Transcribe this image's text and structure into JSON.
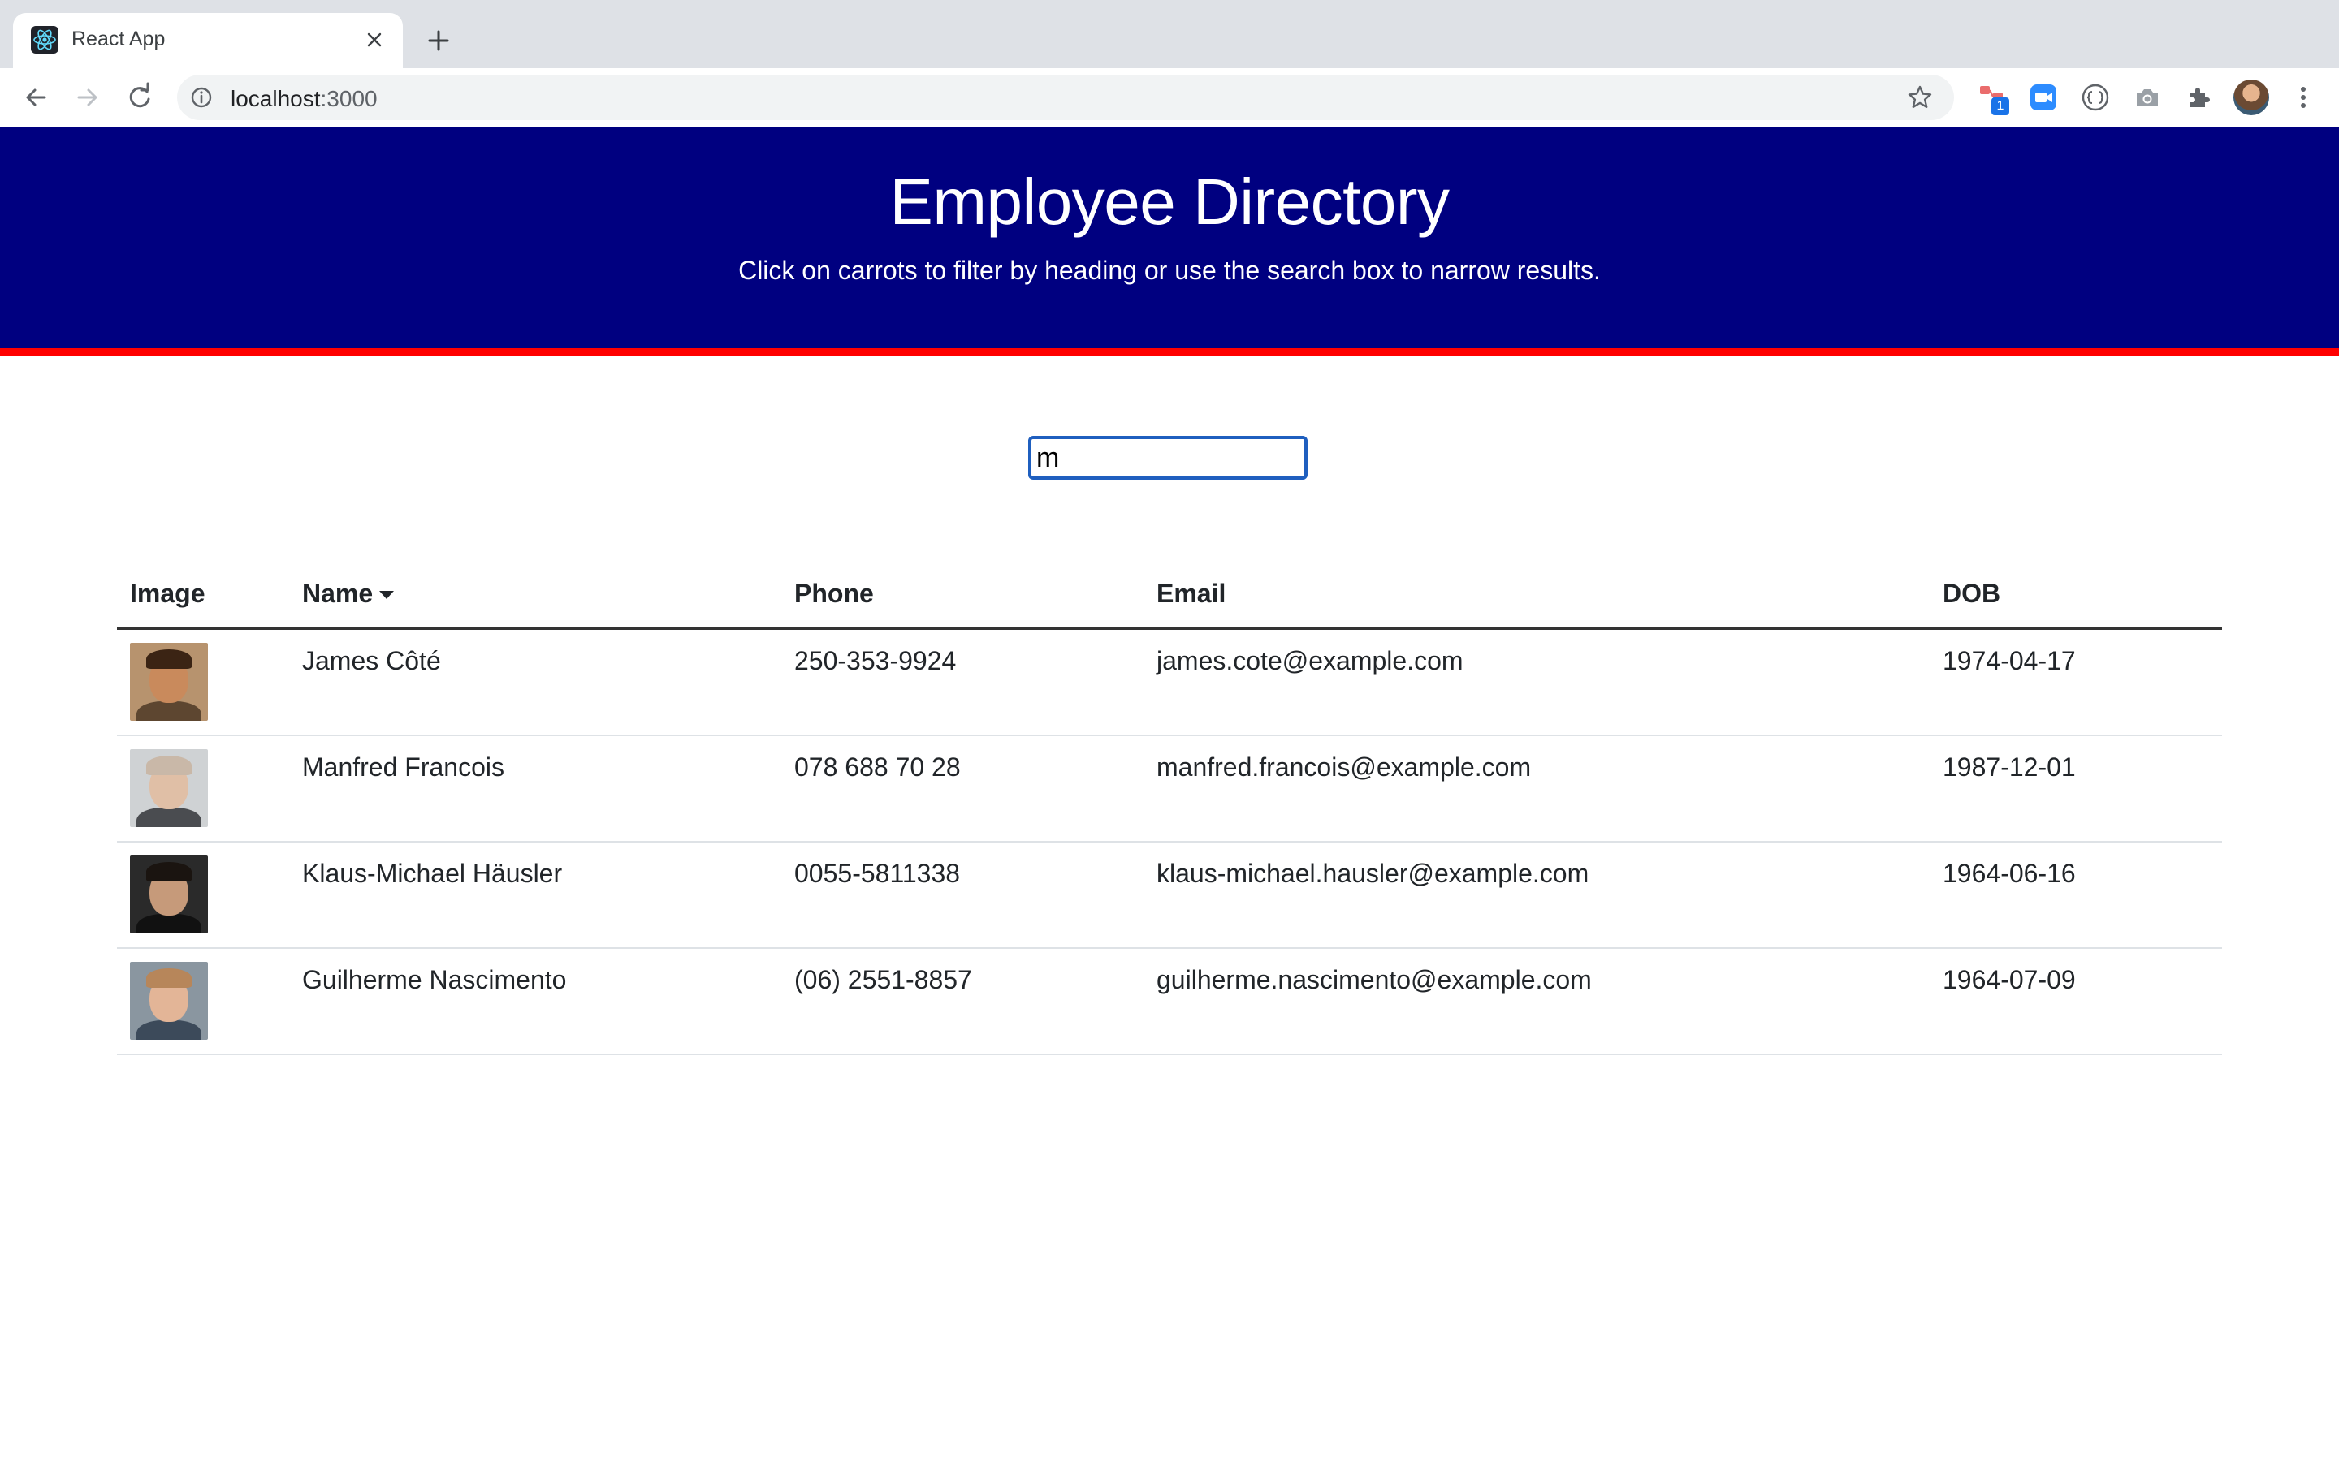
{
  "browser": {
    "tab_title": "React App",
    "url_host": "localhost",
    "url_port": ":3000",
    "extension_badge": "1"
  },
  "header": {
    "title": "Employee Directory",
    "subtitle": "Click on carrots to filter by heading or use the search box to narrow results."
  },
  "search": {
    "value": "m",
    "placeholder": ""
  },
  "table": {
    "columns": {
      "image": "Image",
      "name": "Name",
      "phone": "Phone",
      "email": "Email",
      "dob": "DOB"
    },
    "rows": [
      {
        "name": "James Côté",
        "phone": "250-353-9924",
        "email": "james.cote@example.com",
        "dob": "1974-04-17",
        "photo": {
          "bg": "#b7936e",
          "skin": "#c98a5c",
          "hair": "#3b2414",
          "shirt": "#5d4630"
        }
      },
      {
        "name": "Manfred Francois",
        "phone": "078 688 70 28",
        "email": "manfred.francois@example.com",
        "dob": "1987-12-01",
        "photo": {
          "bg": "#cfd2d4",
          "skin": "#e0bfa6",
          "hair": "#c9b8a8",
          "shirt": "#4a4c50"
        }
      },
      {
        "name": "Klaus-Michael Häusler",
        "phone": "0055-5811338",
        "email": "klaus-michael.hausler@example.com",
        "dob": "1964-06-16",
        "photo": {
          "bg": "#2a2a2a",
          "skin": "#c69a7a",
          "hair": "#1a1410",
          "shirt": "#111111"
        }
      },
      {
        "name": "Guilherme Nascimento",
        "phone": "(06) 2551-8857",
        "email": "guilherme.nascimento@example.com",
        "dob": "1964-07-09",
        "photo": {
          "bg": "#8a96a0",
          "skin": "#e3b597",
          "hair": "#b7865a",
          "shirt": "#3c4a5a"
        }
      }
    ]
  },
  "colors": {
    "header_bg": "#000080",
    "header_border": "#ff0000",
    "search_border": "#1f5fbf"
  }
}
